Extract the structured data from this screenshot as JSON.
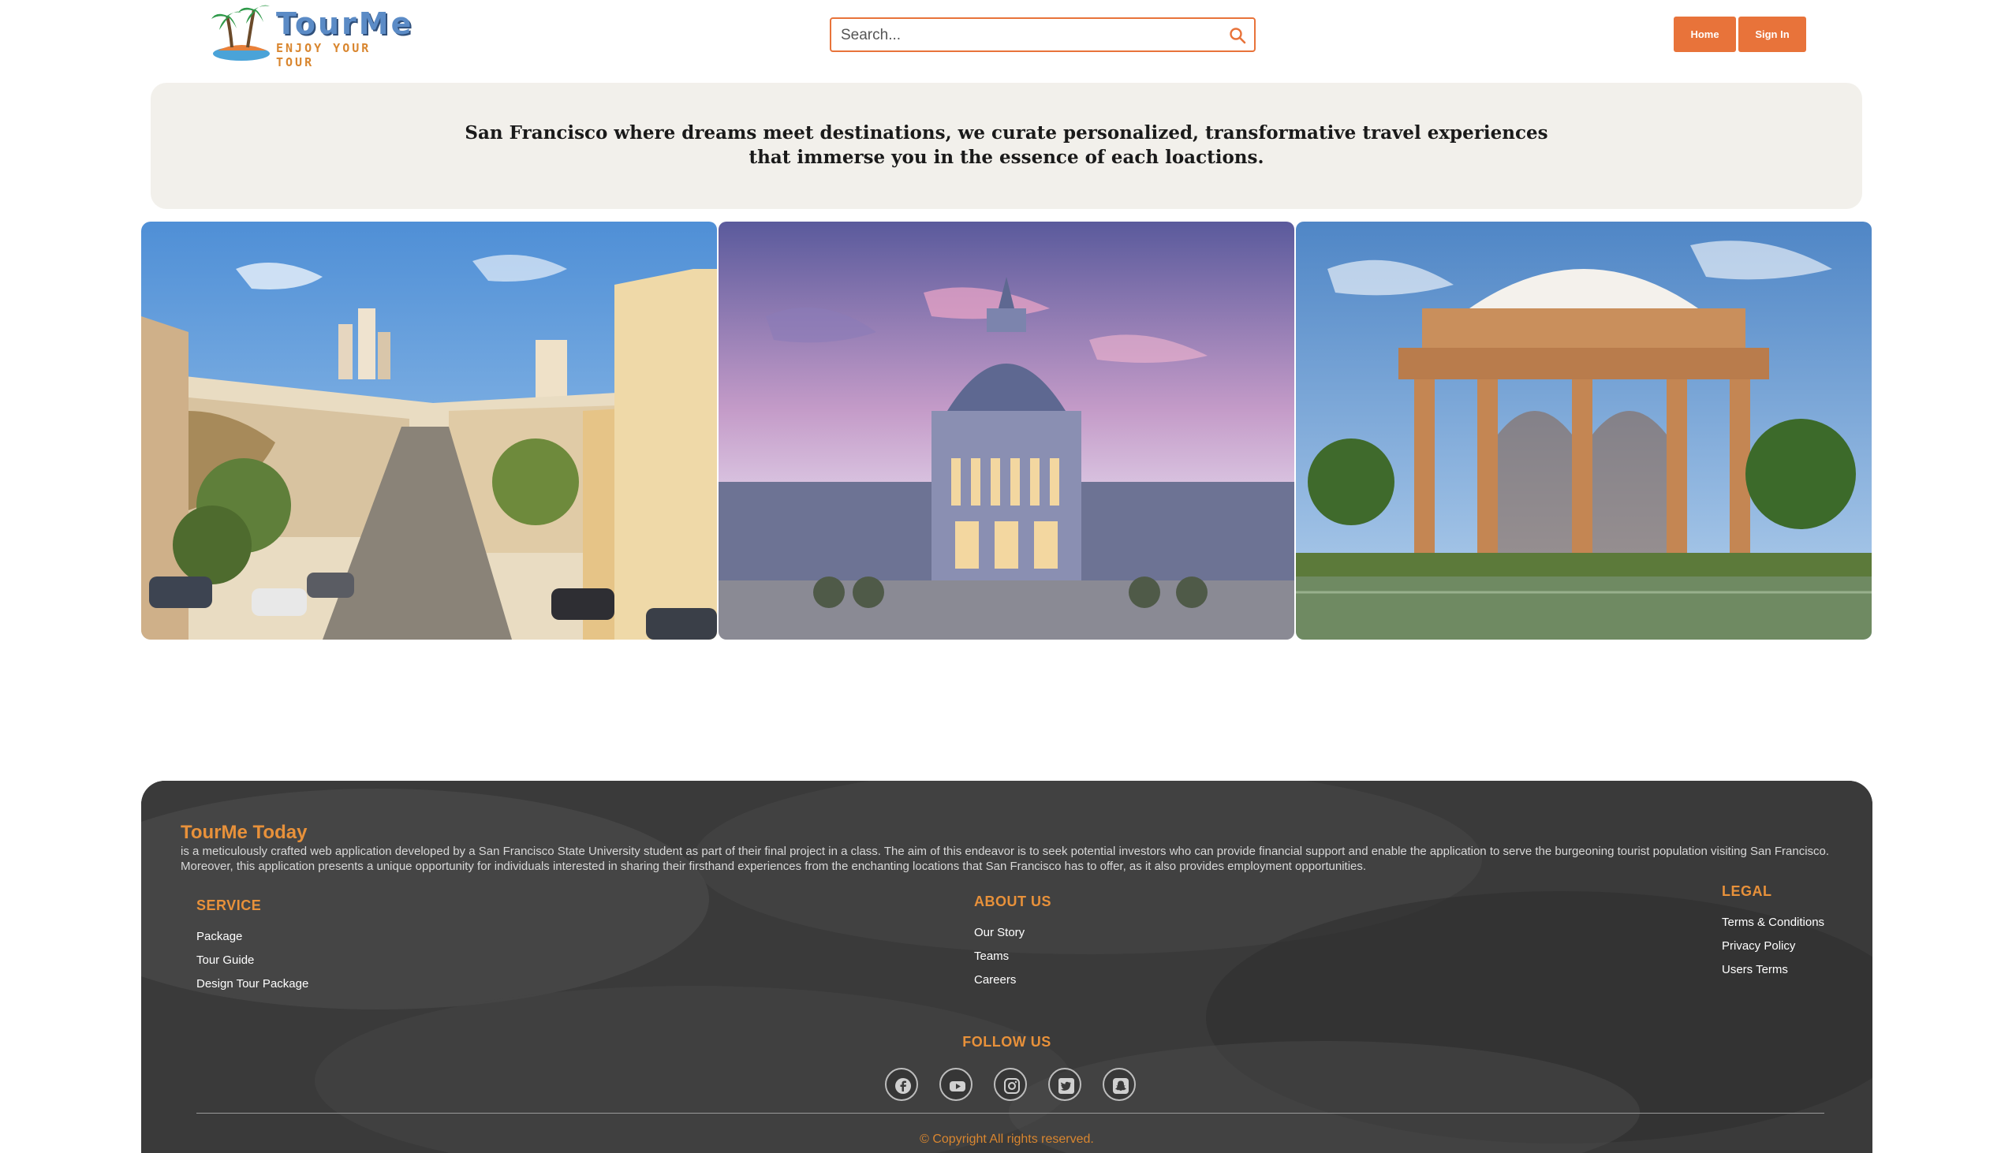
{
  "brand": {
    "name": "TourMe",
    "tagline": "ENJOY YOUR TOUR"
  },
  "search": {
    "placeholder": "Search..."
  },
  "nav": {
    "home_label": "Home",
    "signin_label": "Sign In"
  },
  "hero": {
    "text": "San Francisco where dreams meet destinations, we curate personalized, transformative travel experiences that immerse you in the essence of each loactions."
  },
  "gallery": {
    "images": [
      "street-hill-photo",
      "city-hall-photo",
      "palace-of-fine-arts-photo"
    ]
  },
  "footer": {
    "title": "TourMe Today",
    "description": "is a meticulously crafted web application developed by a San Francisco State University student as part of their final project in a class. The aim of this endeavor is to seek potential investors who can provide financial support and enable the application to serve the burgeoning tourist population visiting San Francisco. Moreover, this application presents a unique opportunity for individuals interested in sharing their firsthand experiences from the enchanting locations that San Francisco has to offer, as it also provides employment opportunities.",
    "service": {
      "heading": "SERVICE",
      "links": [
        "Package",
        "Tour Guide",
        "Design Tour Package"
      ]
    },
    "about": {
      "heading": "ABOUT US",
      "links": [
        "Our Story",
        "Teams",
        "Careers"
      ]
    },
    "legal": {
      "heading": "LEGAL",
      "links": [
        "Terms & Conditions",
        "Privacy Policy",
        "Users Terms"
      ]
    },
    "follow": {
      "heading": "FOLLOW US",
      "icons": [
        "facebook-icon",
        "youtube-icon",
        "instagram-icon",
        "twitter-icon",
        "snapchat-icon"
      ]
    },
    "copyright": "© Copyright All rights reserved."
  },
  "colors": {
    "accent": "#e8733a",
    "footer_heading": "#e8913a",
    "hero_bg": "#f2f0eb",
    "footer_bg": "#3b3b3b"
  }
}
